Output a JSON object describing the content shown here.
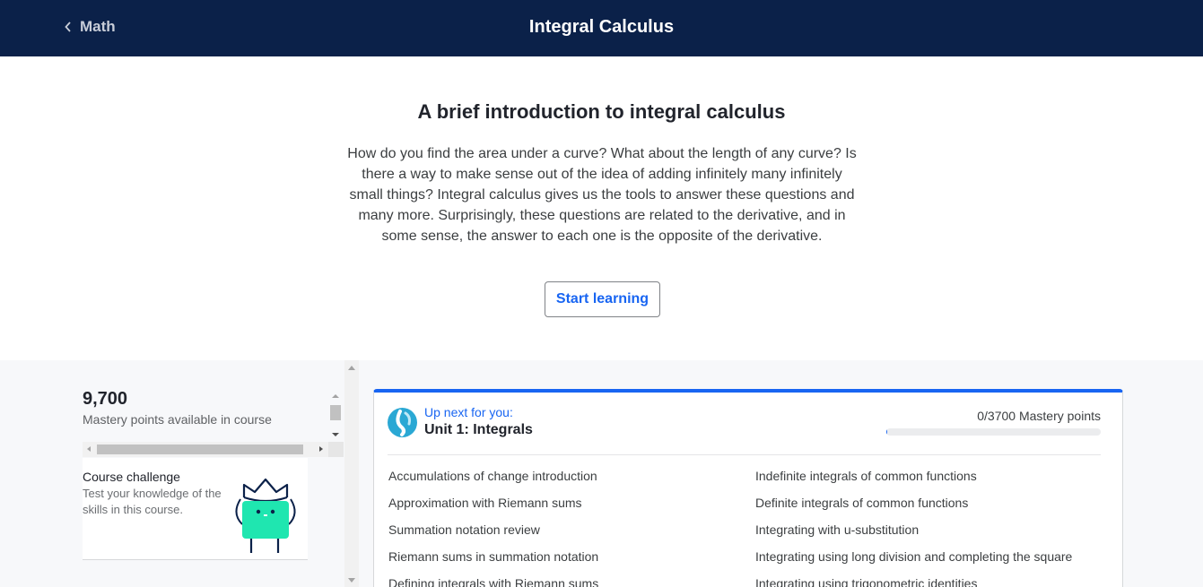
{
  "header": {
    "back_label": "Math",
    "title": "Integral Calculus"
  },
  "intro": {
    "heading": "A brief introduction to integral calculus",
    "body": "How do you find the area under a curve? What about the length of any curve? Is there a way to make sense out of the idea of adding infinitely many infinitely small things? Integral calculus gives us the tools to answer these questions and many more. Surprisingly, these questions are related to the derivative, and in some sense, the answer to each one is the opposite of the derivative.",
    "start_button": "Start learning"
  },
  "sidebar": {
    "mastery_count": "9,700",
    "mastery_label": "Mastery points available in course",
    "challenge": {
      "title": "Course challenge",
      "description": "Test your knowledge of the skills in this course."
    }
  },
  "unit": {
    "up_next": "Up next for you:",
    "title": "Unit 1: Integrals",
    "mastery_points": "0/3700 Mastery points",
    "progress_fraction": 0.005,
    "lessons_left": [
      "Accumulations of change introduction",
      "Approximation with Riemann sums",
      "Summation notation review",
      "Riemann sums in summation notation",
      "Defining integrals with Riemann sums"
    ],
    "lessons_right": [
      "Indefinite integrals of common functions",
      "Definite integrals of common functions",
      "Integrating with u-substitution",
      "Integrating using long division and completing the square",
      "Integrating using trigonometric identities"
    ]
  },
  "colors": {
    "header_bg": "#0b2149",
    "accent": "#1865f2",
    "mascot": "#1fe6b0"
  },
  "icons": {
    "back": "chevron-left-icon",
    "unit": "unit-swirl-icon",
    "challenge": "crowned-mascot-illustration"
  }
}
